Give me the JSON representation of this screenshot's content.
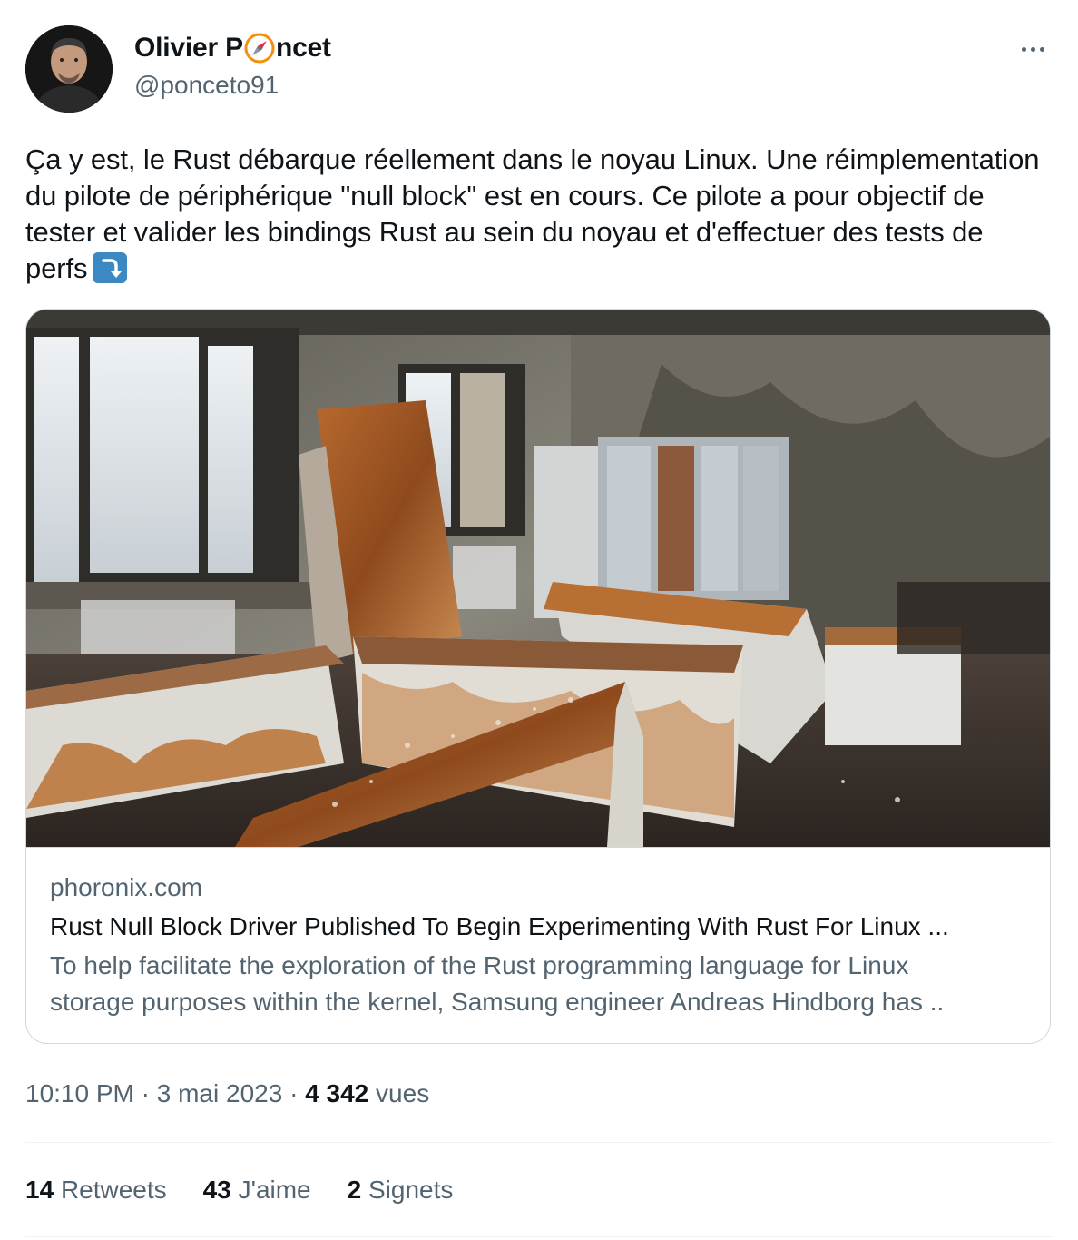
{
  "author": {
    "name_prefix": "Olivier P",
    "name_emoji": "compass-emoji",
    "name_suffix": "ncet",
    "handle": "@ponceto91"
  },
  "tweet": {
    "text": "Ça y est, le Rust débarque réellement dans le noyau Linux. Une réimplementation du pilote de périphérique \"null block\" est en cours. Ce pilote a pour objectif de tester et valider les bindings Rust au sein du noyau et d'effectuer des tests de perfs",
    "trailing_emoji": "arrow-curving-down-emoji"
  },
  "card": {
    "domain": "phoronix.com",
    "title": "Rust Null Block Driver Published To Begin Experimenting With Rust For Linux ...",
    "description_line1": "To help facilitate the exploration of the Rust programming language for Linux",
    "description_line2": "storage purposes within the kernel, Samsung engineer Andreas Hindborg has .."
  },
  "meta": {
    "time": "10:10 PM",
    "separator": "·",
    "date": "3 mai 2023",
    "views_count": "4 342",
    "views_label": "vues"
  },
  "stats": {
    "retweets_count": "14",
    "retweets_label": "Retweets",
    "likes_count": "43",
    "likes_label": "J'aime",
    "bookmarks_count": "2",
    "bookmarks_label": "Signets"
  },
  "colors": {
    "text_primary": "#0f1419",
    "text_secondary": "#536471",
    "border": "#cfd9de",
    "emoji_blue": "#3b88c3",
    "rust": "#a55a24"
  }
}
